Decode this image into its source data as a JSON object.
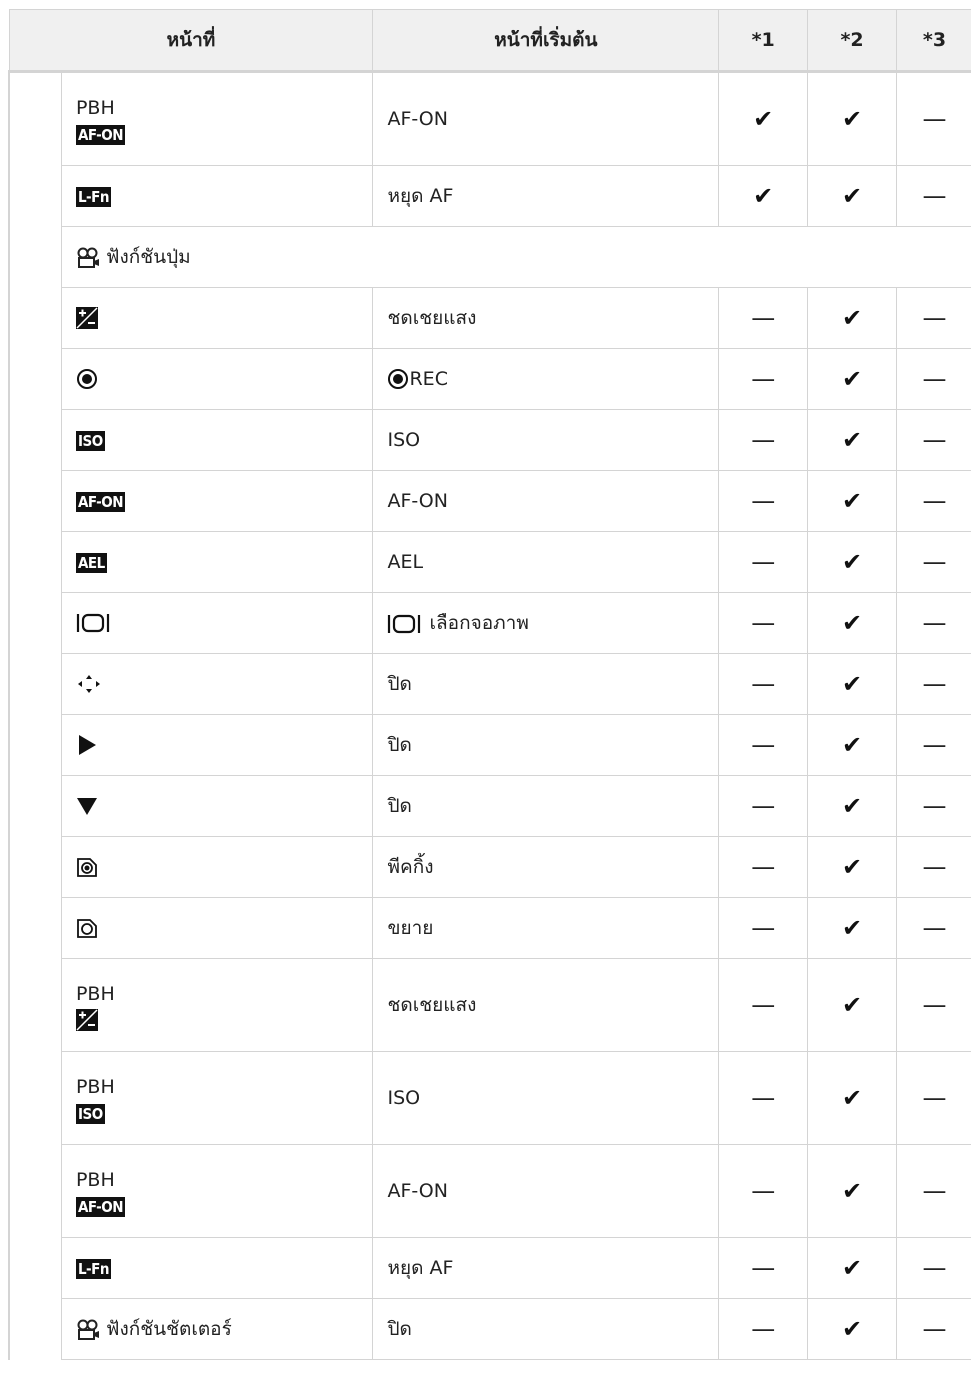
{
  "header": {
    "function": "หน้าที่",
    "default": "หน้าที่เริ่มต้น",
    "m1": "*1",
    "m2": "*2",
    "m3": "*3"
  },
  "marks": {
    "check": "✔",
    "dash": "—"
  },
  "rows": [
    {
      "prefix": "PBH",
      "icon": "AF-ON",
      "default": "AF-ON",
      "m1": "✔",
      "m2": "✔",
      "m3": "—"
    },
    {
      "icon": "L-Fn",
      "default": "หยุด AF",
      "m1": "✔",
      "m2": "✔",
      "m3": "—"
    }
  ],
  "section_button": {
    "icon": "movie-icon",
    "label": "ฟังก์ชันปุ่ม"
  },
  "button_rows": [
    {
      "icon": "exposure-comp-icon",
      "default": "ชดเชยแสง",
      "m1": "—",
      "m2": "✔",
      "m3": "—"
    },
    {
      "icon": "record-icon",
      "default": "REC",
      "m1": "—",
      "m2": "✔",
      "m3": "—"
    },
    {
      "icon": "ISO",
      "default": "ISO",
      "m1": "—",
      "m2": "✔",
      "m3": "—"
    },
    {
      "icon": "AF-ON",
      "default": "AF-ON",
      "m1": "—",
      "m2": "✔",
      "m3": "—"
    },
    {
      "icon": "AEL",
      "default": "AEL",
      "m1": "—",
      "m2": "✔",
      "m3": "—"
    },
    {
      "icon": "monitor-select-icon",
      "default": "เลือกจอภาพ",
      "m1": "—",
      "m2": "✔",
      "m3": "—"
    },
    {
      "icon": "arrow-pad-icon",
      "default": "ปิด",
      "m1": "—",
      "m2": "✔",
      "m3": "—"
    },
    {
      "icon": "right-arrow-icon",
      "default": "ปิด",
      "m1": "—",
      "m2": "✔",
      "m3": "—"
    },
    {
      "icon": "down-arrow-icon",
      "default": "ปิด",
      "m1": "—",
      "m2": "✔",
      "m3": "—"
    },
    {
      "icon": "peaking-icon",
      "default": "พีคกิ้ง",
      "m1": "—",
      "m2": "✔",
      "m3": "—"
    },
    {
      "icon": "magnify-icon",
      "default": "ขยาย",
      "m1": "—",
      "m2": "✔",
      "m3": "—"
    },
    {
      "prefix": "PBH",
      "icon": "exposure-comp-icon",
      "default": "ชดเชยแสง",
      "m1": "—",
      "m2": "✔",
      "m3": "—"
    },
    {
      "prefix": "PBH",
      "icon": "ISO",
      "default": "ISO",
      "m1": "—",
      "m2": "✔",
      "m3": "—"
    },
    {
      "prefix": "PBH",
      "icon": "AF-ON",
      "default": "AF-ON",
      "m1": "—",
      "m2": "✔",
      "m3": "—"
    },
    {
      "icon": "L-Fn",
      "default": "หยุด AF",
      "m1": "—",
      "m2": "✔",
      "m3": "—"
    }
  ],
  "section_shutter": {
    "icon": "movie-icon",
    "label": "ฟังก์ชันชัตเตอร์",
    "default": "ปิด",
    "m1": "—",
    "m2": "✔",
    "m3": "—"
  }
}
